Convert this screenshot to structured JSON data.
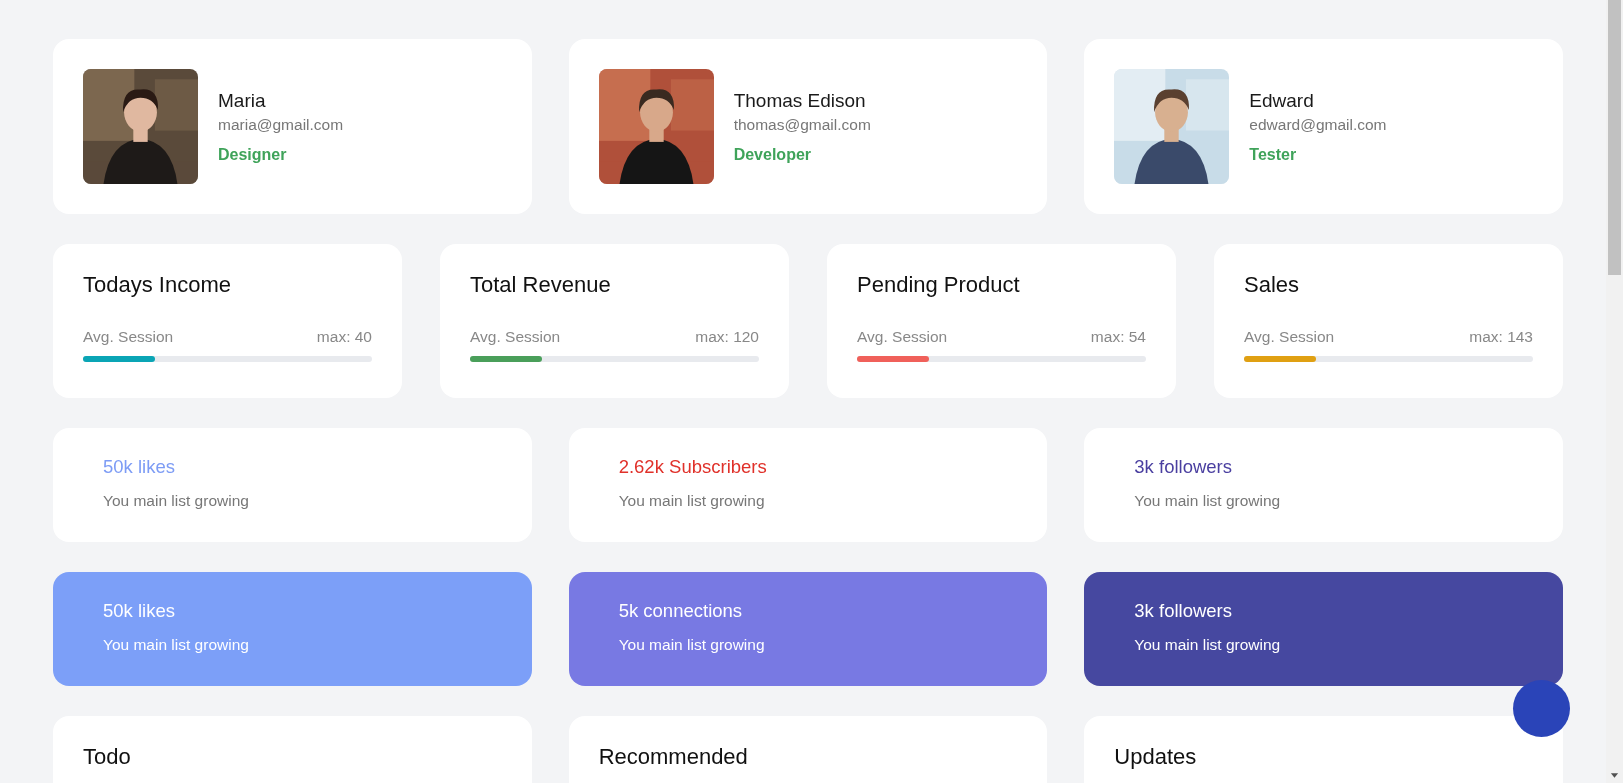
{
  "profiles": [
    {
      "name": "Maria",
      "email": "maria@gmail.com",
      "role": "Designer"
    },
    {
      "name": "Thomas Edison",
      "email": "thomas@gmail.com",
      "role": "Developer"
    },
    {
      "name": "Edward",
      "email": "edward@gmail.com",
      "role": "Tester"
    }
  ],
  "stats": [
    {
      "title": "Todays Income",
      "label": "Avg. Session",
      "max": "max: 40",
      "level": 0.25,
      "color": "#0aa5b5"
    },
    {
      "title": "Total Revenue",
      "label": "Avg. Session",
      "max": "max: 120",
      "level": 0.25,
      "color": "#4a9f5a"
    },
    {
      "title": "Pending Product",
      "label": "Avg. Session",
      "max": "max: 54",
      "level": 0.25,
      "color": "#f0605a"
    },
    {
      "title": "Sales",
      "label": "Avg. Session",
      "max": "max: 143",
      "level": 0.25,
      "color": "#e0a012"
    }
  ],
  "metrics": [
    {
      "value": "50k likes",
      "caption": "You main list growing",
      "color": "#7d9cf5"
    },
    {
      "value": "2.62k Subscribers",
      "caption": "You main list growing",
      "color": "#e0312a"
    },
    {
      "value": "3k followers",
      "caption": "You main list growing",
      "color": "#4a3fa0"
    }
  ],
  "highlights": [
    {
      "value": "50k likes",
      "caption": "You main list growing",
      "color": "#7c9ff8"
    },
    {
      "value": "5k connections",
      "caption": "You main list growing",
      "color": "#7879e3"
    },
    {
      "value": "3k followers",
      "caption": "You main list growing",
      "color": "#4648a0"
    }
  ],
  "sections": [
    {
      "title": "Todo"
    },
    {
      "title": "Recommended"
    },
    {
      "title": "Updates"
    }
  ]
}
